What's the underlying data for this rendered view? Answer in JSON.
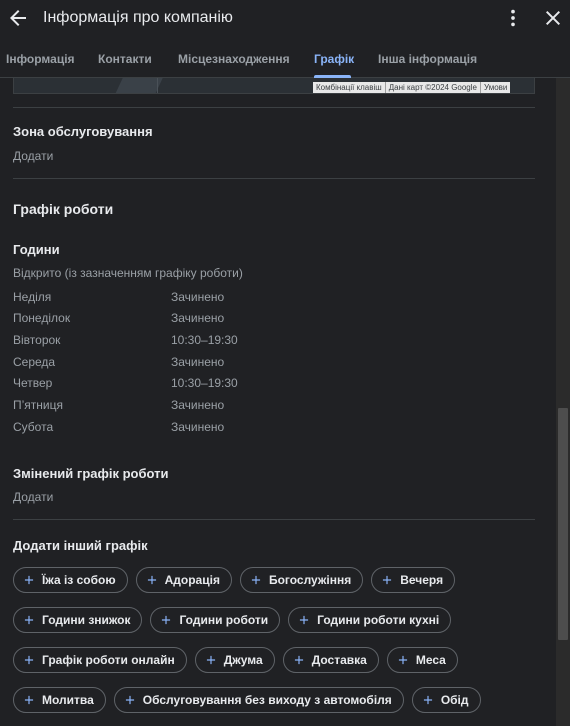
{
  "header": {
    "title": "Інформація про компанію"
  },
  "tabs": [
    {
      "label": "Інформація",
      "active": false
    },
    {
      "label": "Контакти",
      "active": false
    },
    {
      "label": "Місцезнаходження",
      "active": false
    },
    {
      "label": "Графік",
      "active": true
    },
    {
      "label": "Інша інформація",
      "active": false
    }
  ],
  "map": {
    "attribution": [
      "Комбінації клавіш",
      "Дані карт ©2024 Google",
      "Умови"
    ]
  },
  "service_area": {
    "title": "Зона обслуговування",
    "action": "Додати"
  },
  "schedule": {
    "title": "Графік роботи",
    "hours_title": "Години",
    "status": "Відкрито (із зазначенням графіку роботи)",
    "days": [
      {
        "day": "Неділя",
        "time": "Зачинено"
      },
      {
        "day": "Понеділок",
        "time": "Зачинено"
      },
      {
        "day": "Вівторок",
        "time": "10:30–19:30"
      },
      {
        "day": "Середа",
        "time": "Зачинено"
      },
      {
        "day": "Четвер",
        "time": "10:30–19:30"
      },
      {
        "day": "П’ятниця",
        "time": "Зачинено"
      },
      {
        "day": "Субота",
        "time": "Зачинено"
      }
    ]
  },
  "special_hours": {
    "title": "Змінений графік роботи",
    "action": "Додати"
  },
  "more_hours": {
    "title": "Додати інший графік",
    "chip_rows": [
      [
        "Їжа із собою",
        "Адорація",
        "Богослужіння",
        "Вечеря"
      ],
      [
        "Години знижок",
        "Години роботи",
        "Години роботи кухні"
      ],
      [
        "Графік роботи онлайн",
        "Джума",
        "Доставка",
        "Меса"
      ],
      [
        "Молитва",
        "Обслуговування без виходу з автомобіля",
        "Обід"
      ]
    ]
  },
  "colors": {
    "accent": "#8ab4f8",
    "background": "#202124",
    "text": "#e8eaed",
    "muted": "#9aa0a6"
  }
}
